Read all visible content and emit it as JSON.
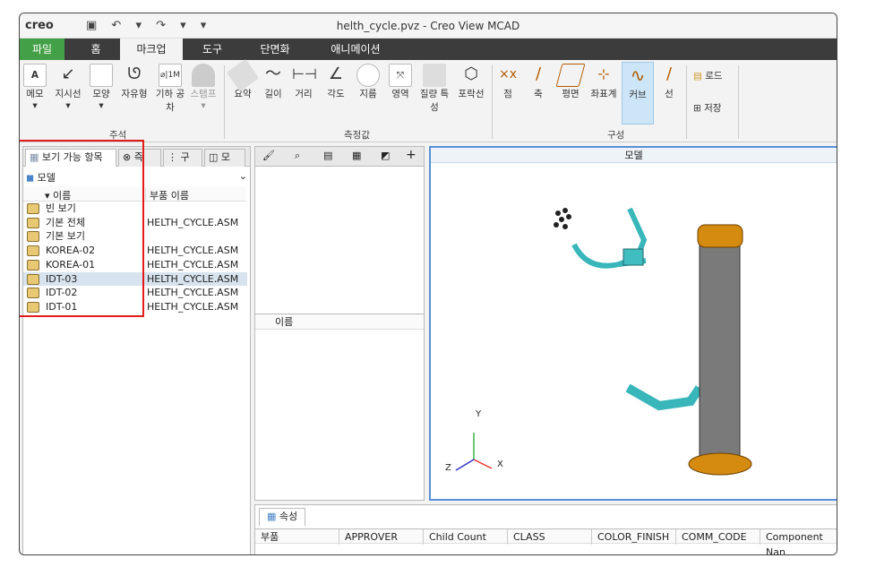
{
  "app": {
    "logo": "creo",
    "title": "helth_cycle.pvz - Creo View MCAD"
  },
  "tabs": [
    "파일",
    "홈",
    "마크업",
    "도구",
    "단면화",
    "애니메이션"
  ],
  "ribbon": {
    "annotation": {
      "label": "주석",
      "items": [
        "메모",
        "지시선",
        "모양",
        "자유형",
        "기하 공차",
        "스탬프"
      ]
    },
    "measure": {
      "label": "측정값",
      "items": [
        "요약",
        "길이",
        "거리",
        "각도",
        "지름",
        "영역",
        "질량 특성",
        "포락선"
      ]
    },
    "build": {
      "label": "구성",
      "items": [
        "점",
        "축",
        "평면",
        "좌표계",
        "커브",
        "선"
      ]
    },
    "file": {
      "items": [
        "로드",
        "저장"
      ]
    }
  },
  "left_panel": {
    "tabs": [
      "보기 가능 항목",
      "즉",
      "구",
      "모"
    ],
    "dropdown": "모델",
    "col_name": "이름",
    "col_part": "부품 이름",
    "rows": [
      {
        "name": "빈 보기",
        "part": ""
      },
      {
        "name": "기본 전체",
        "part": "HELTH_CYCLE.ASM"
      },
      {
        "name": "기본 보기",
        "part": ""
      },
      {
        "name": "KOREA-02",
        "part": "HELTH_CYCLE.ASM"
      },
      {
        "name": "KOREA-01",
        "part": "HELTH_CYCLE.ASM"
      },
      {
        "name": "IDT-03",
        "part": "HELTH_CYCLE.ASM"
      },
      {
        "name": "IDT-02",
        "part": "HELTH_CYCLE.ASM"
      },
      {
        "name": "IDT-01",
        "part": "HELTH_CYCLE.ASM"
      }
    ]
  },
  "middle_panel": {
    "col_name": "이름"
  },
  "viewport": {
    "title": "모델",
    "axis_x": "X",
    "axis_y": "Y",
    "axis_z": "Z"
  },
  "bottom_panel": {
    "tab": "속성",
    "columns": [
      "부품",
      "APPROVER",
      "Child Count",
      "CLASS",
      "COLOR_FINISH",
      "COMM_CODE",
      "Component Nan"
    ]
  }
}
